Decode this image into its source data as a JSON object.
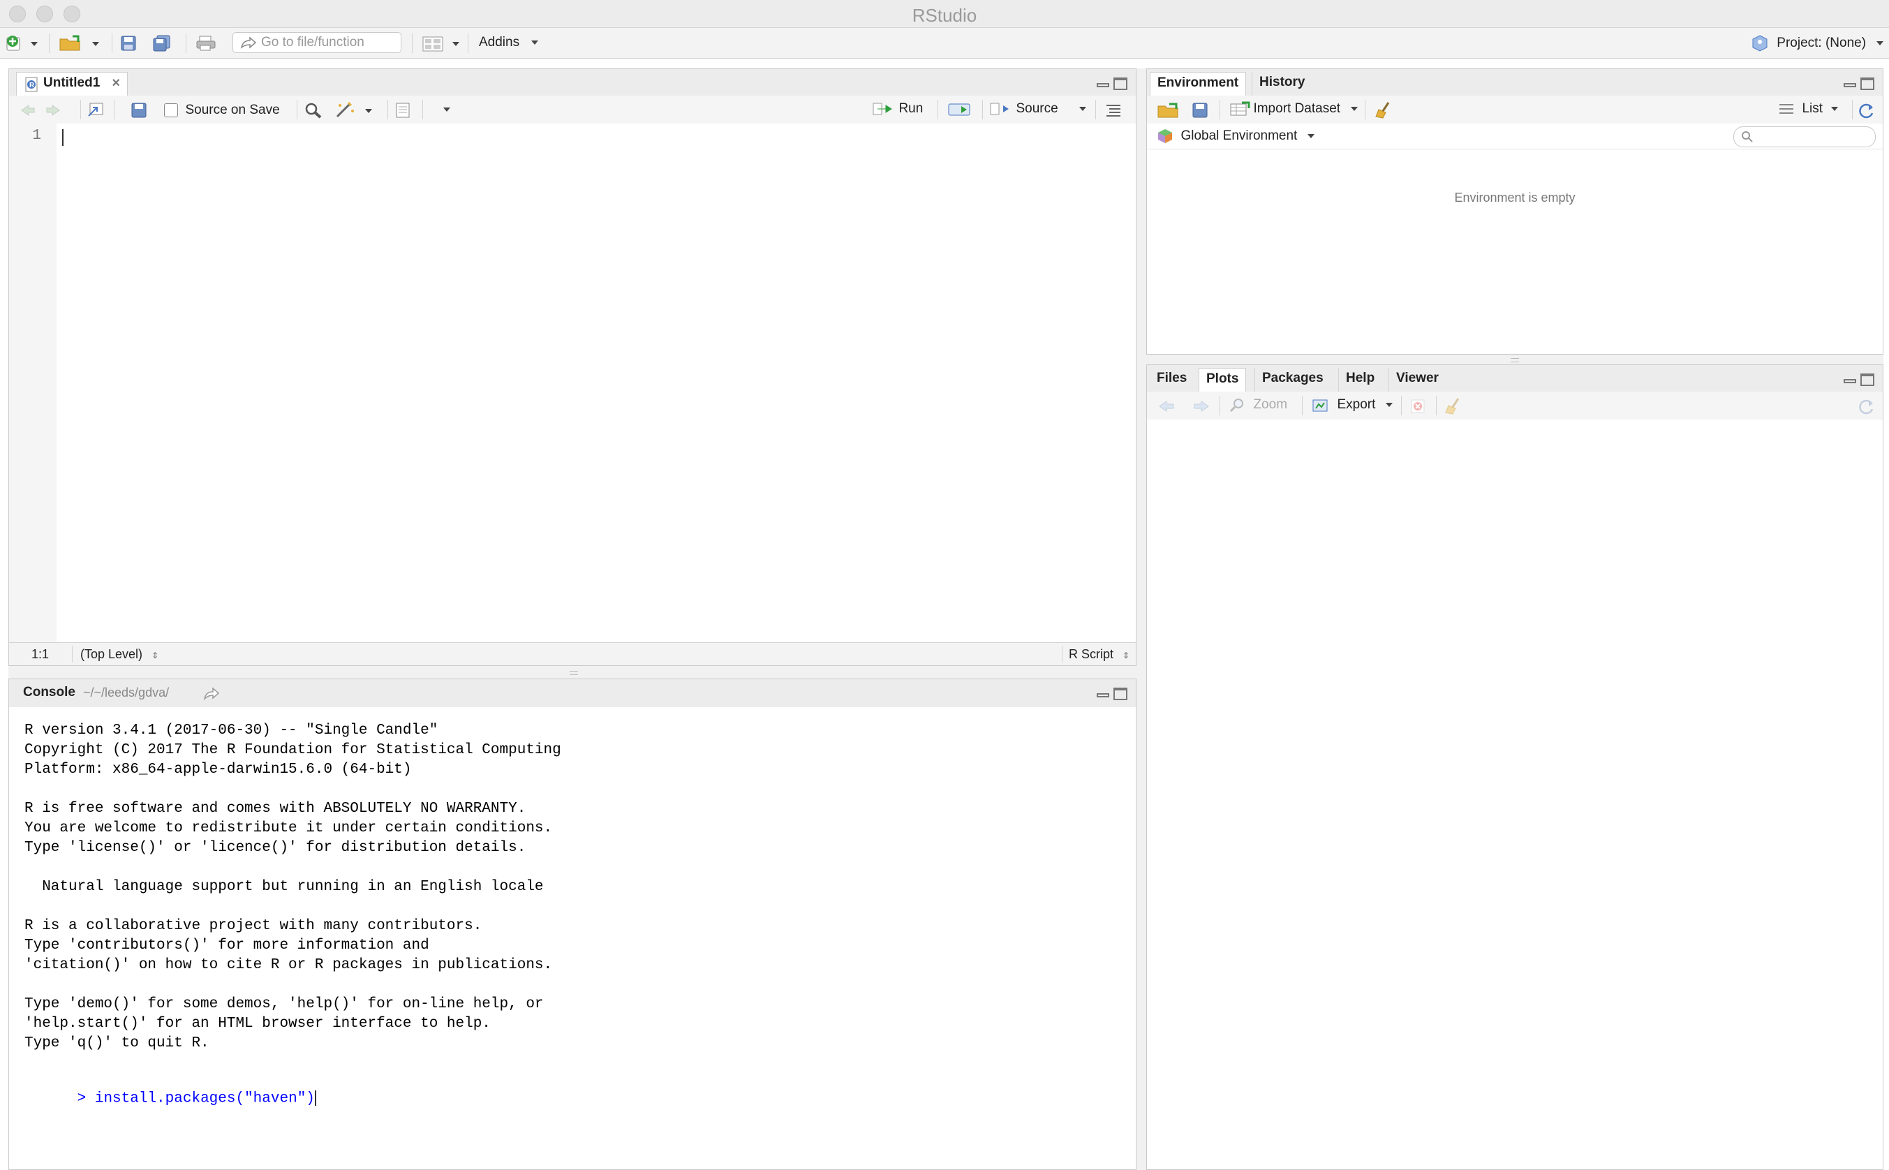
{
  "window": {
    "title": "RStudio"
  },
  "toolbar": {
    "goto_placeholder": "Go to file/function",
    "addins_label": "Addins",
    "project_label": "Project: (None)"
  },
  "editor": {
    "tab_label": "Untitled1",
    "source_on_save_label": "Source on Save",
    "run_label": "Run",
    "source_label": "Source",
    "line_number": "1",
    "cursor_pos": "1:1",
    "scope": "(Top Level)",
    "file_type": "R Script"
  },
  "console": {
    "title": "Console",
    "path": "~/~/leeds/gdva/",
    "lines": [
      "R version 3.4.1 (2017-06-30) -- \"Single Candle\"",
      "Copyright (C) 2017 The R Foundation for Statistical Computing",
      "Platform: x86_64-apple-darwin15.6.0 (64-bit)",
      "",
      "R is free software and comes with ABSOLUTELY NO WARRANTY.",
      "You are welcome to redistribute it under certain conditions.",
      "Type 'license()' or 'licence()' for distribution details.",
      "",
      "  Natural language support but running in an English locale",
      "",
      "R is a collaborative project with many contributors.",
      "Type 'contributors()' for more information and",
      "'citation()' on how to cite R or R packages in publications.",
      "",
      "Type 'demo()' for some demos, 'help()' for on-line help, or",
      "'help.start()' for an HTML browser interface to help.",
      "Type 'q()' to quit R."
    ],
    "prompt": ">",
    "command": "install.packages(\"haven\")"
  },
  "environment": {
    "tabs": [
      "Environment",
      "History"
    ],
    "import_label": "Import Dataset",
    "list_label": "List",
    "global_env_label": "Global Environment",
    "empty_message": "Environment is empty"
  },
  "files_pane": {
    "tabs": [
      "Files",
      "Plots",
      "Packages",
      "Help",
      "Viewer"
    ],
    "zoom_label": "Zoom",
    "export_label": "Export"
  },
  "colors": {
    "command_blue": "#0000ff",
    "run_green": "#2e9e3c",
    "accent_blue": "#4a78c2"
  }
}
